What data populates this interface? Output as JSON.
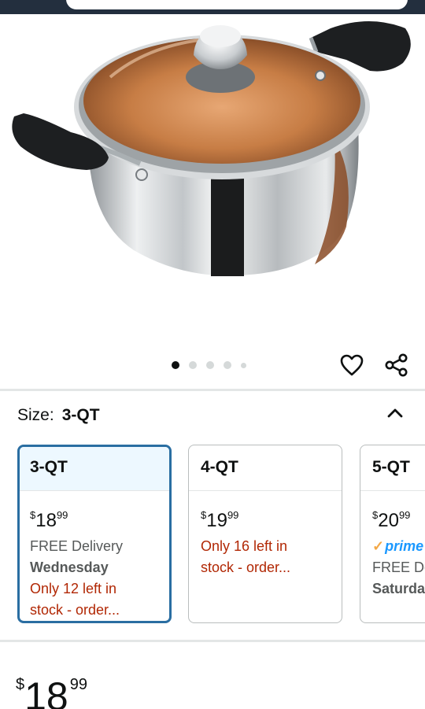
{
  "gallery": {
    "image_alt": "Stainless steel stockpot with glass lid",
    "dot_count": 5,
    "active_dot": 0
  },
  "variant": {
    "size_label": "Size:",
    "size_value": "3-QT"
  },
  "cards": [
    {
      "name": "3-QT",
      "price_currency": "$",
      "price_whole": "18",
      "price_cents": "99",
      "delivery": "FREE Delivery",
      "delivery_day": "Wednesday",
      "stock_line1": "Only 12 left in",
      "stock_line2": "stock - order...",
      "selected": true
    },
    {
      "name": "4-QT",
      "price_currency": "$",
      "price_whole": "19",
      "price_cents": "99",
      "stock_line1": "Only 16 left in",
      "stock_line2": "stock - order..."
    },
    {
      "name": "5-QT",
      "price_currency": "$",
      "price_whole": "20",
      "price_cents": "99",
      "prime_label": "prime",
      "delivery": "FREE De",
      "delivery_day": "Saturda"
    }
  ],
  "price": {
    "currency": "$",
    "whole": "18",
    "cents": "99"
  },
  "colors": {
    "header": "#232f3e",
    "selected_border": "#2a6ea2",
    "selected_header_bg": "#edf8ff",
    "stock_red": "#b12704",
    "prime_blue": "#1a98ff"
  }
}
